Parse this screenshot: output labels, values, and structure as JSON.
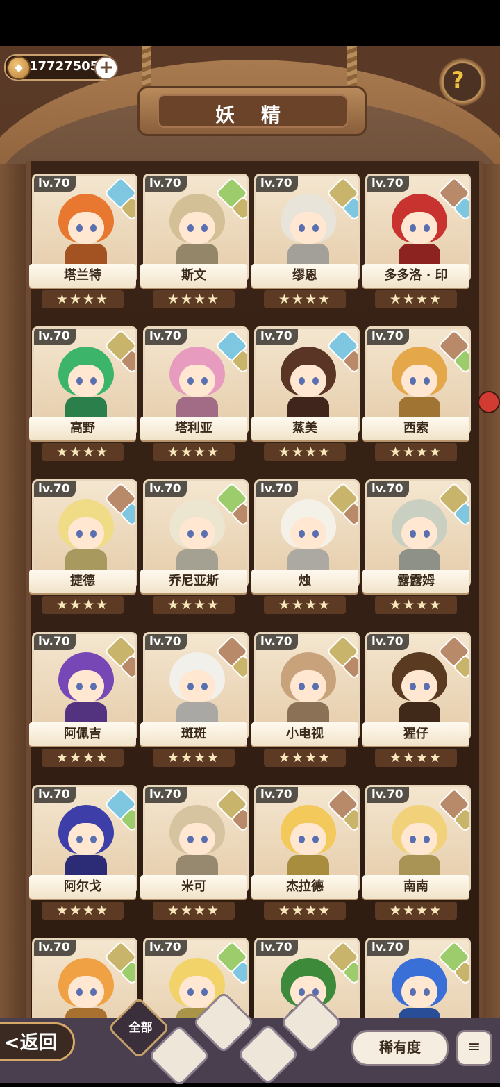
{
  "currency": {
    "icon": "coin-icon",
    "value": "17727505",
    "add_icon": "plus-icon"
  },
  "help": {
    "icon": "question-sprout-icon"
  },
  "title": "妖 精",
  "characters": [
    {
      "level": "lv.70",
      "name": "塔兰特",
      "stars": "★★★★",
      "hair": "#e8772f",
      "elements": [
        "#7fc7e0",
        "#c9b46b"
      ]
    },
    {
      "level": "lv.70",
      "name": "斯文",
      "stars": "★★★★",
      "hair": "#d4c096",
      "elements": [
        "#9ccc6c",
        "#c9b46b"
      ]
    },
    {
      "level": "lv.70",
      "name": "缪恩",
      "stars": "★★★★",
      "hair": "#e9e4da",
      "elements": [
        "#c9b46b",
        "#7fc7e0"
      ]
    },
    {
      "level": "lv.70",
      "name": "多多洛 · 印",
      "stars": "★★★★",
      "hair": "#c8322f",
      "elements": [
        "#b98a6a",
        "#7fc7e0"
      ]
    },
    {
      "level": "lv.70",
      "name": "高野",
      "stars": "★★★★",
      "hair": "#3cb56a",
      "elements": [
        "#c9b46b",
        "#b98a6a"
      ]
    },
    {
      "level": "lv.70",
      "name": "塔利亚",
      "stars": "★★★★",
      "hair": "#e79bbf",
      "elements": [
        "#7fc7e0",
        "#c9b46b"
      ]
    },
    {
      "level": "lv.70",
      "name": "蒸美",
      "stars": "★★★★",
      "hair": "#5a3526",
      "elements": [
        "#7fc7e0",
        "#b98a6a"
      ]
    },
    {
      "level": "lv.70",
      "name": "西索",
      "stars": "★★★★",
      "hair": "#e4a74a",
      "elements": [
        "#b98a6a",
        "#9ccc6c"
      ]
    },
    {
      "level": "lv.70",
      "name": "捷德",
      "stars": "★★★★",
      "hair": "#f0dc87",
      "elements": [
        "#b98a6a",
        "#7fc7e0"
      ]
    },
    {
      "level": "lv.70",
      "name": "乔尼亚斯",
      "stars": "★★★★",
      "hair": "#ece6d0",
      "elements": [
        "#9ccc6c",
        "#b98a6a"
      ]
    },
    {
      "level": "lv.70",
      "name": "烛",
      "stars": "★★★★",
      "hair": "#f4f2e8",
      "elements": [
        "#c9b46b",
        "#b98a6a"
      ]
    },
    {
      "level": "lv.70",
      "name": "露露姆",
      "stars": "★★★★",
      "hair": "#c9cfc1",
      "elements": [
        "#c9b46b",
        "#7fc7e0"
      ]
    },
    {
      "level": "lv.70",
      "name": "阿佩吉",
      "stars": "★★★★",
      "hair": "#7747b6",
      "elements": [
        "#c9b46b",
        "#b98a6a"
      ]
    },
    {
      "level": "lv.70",
      "name": "斑斑",
      "stars": "★★★★",
      "hair": "#f2f0ea",
      "elements": [
        "#b98a6a",
        "#c9b46b"
      ]
    },
    {
      "level": "lv.70",
      "name": "小电视",
      "stars": "★★★★",
      "hair": "#c7a27a",
      "elements": [
        "#c9b46b",
        "#b98a6a"
      ]
    },
    {
      "level": "lv.70",
      "name": "猩仔",
      "stars": "★★★★",
      "hair": "#5b3a22",
      "elements": [
        "#b98a6a",
        "#c9b46b"
      ]
    },
    {
      "level": "lv.70",
      "name": "阿尔戈",
      "stars": "★★★★",
      "hair": "#3e3ea8",
      "elements": [
        "#7fc7e0",
        "#9ccc6c"
      ]
    },
    {
      "level": "lv.70",
      "name": "米可",
      "stars": "★★★★",
      "hair": "#d6c3a0",
      "elements": [
        "#c9b46b",
        "#b98a6a"
      ]
    },
    {
      "level": "lv.70",
      "name": "杰拉德",
      "stars": "★★★★",
      "hair": "#f2c95a",
      "elements": [
        "#b98a6a",
        "#c9b46b"
      ]
    },
    {
      "level": "lv.70",
      "name": "南南",
      "stars": "★★★★",
      "hair": "#f1d27a",
      "elements": [
        "#b98a6a",
        "#c9b46b"
      ]
    },
    {
      "level": "lv.70",
      "name": "",
      "stars": "",
      "hair": "#f0a144",
      "elements": [
        "#c9b46b",
        "#9ccc6c"
      ]
    },
    {
      "level": "lv.70",
      "name": "",
      "stars": "",
      "hair": "#f2d36a",
      "elements": [
        "#9ccc6c",
        "#7fc7e0"
      ]
    },
    {
      "level": "lv.70",
      "name": "",
      "stars": "",
      "hair": "#3c8a3a",
      "elements": [
        "#c9b46b",
        "#9ccc6c"
      ]
    },
    {
      "level": "lv.70",
      "name": "",
      "stars": "",
      "hair": "#3b6fd8",
      "elements": [
        "#9ccc6c",
        "#c9b46b"
      ]
    }
  ],
  "bottom": {
    "back_label": "<返回",
    "filter_all_label": "全部",
    "filters": [
      "sprout-filter-icon",
      "water-filter-icon",
      "earth-filter-icon",
      "mountain-filter-icon"
    ],
    "rarity_label": "稀有度",
    "sort_icon": "sort-icon"
  }
}
